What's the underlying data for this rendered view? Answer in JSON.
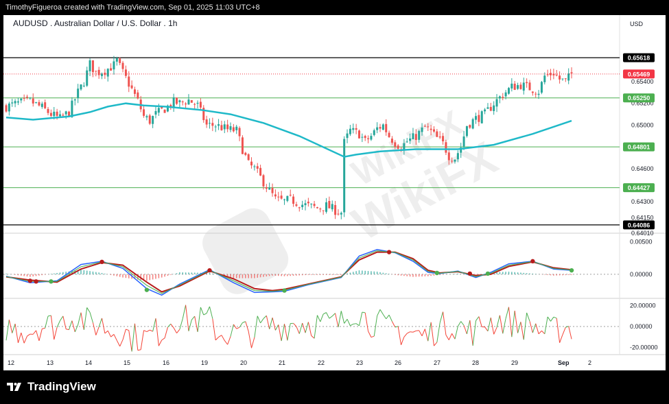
{
  "header": {
    "attribution": "TimothyFigueroa created with TradingView.com, Sep 01, 2025 11:03 UTC+8"
  },
  "footer": {
    "brand": "TradingView"
  },
  "watermark": {
    "text": "WikiFX"
  },
  "colors": {
    "bull": "#26a69a",
    "bear": "#ef5350",
    "ma": "#1fb9c8",
    "level_line": "#4caf50",
    "resistance_line": "#000000",
    "current_price": "#f23645",
    "macd_fast": "#2962ff",
    "macd_slow": "#b71c1c",
    "signal_up": "#4caf50",
    "signal_down": "#b71c1c",
    "osc_up": "#4caf50",
    "osc_down": "#f44336"
  },
  "chart_data": [
    {
      "type": "candlestick",
      "title": "AUDUSD . Australian Dollar / U.S. Dollar . 1h",
      "currency": "USD",
      "ylim": [
        0.6401,
        0.6582
      ],
      "y_ticks": [
        "0.65400",
        "0.65200",
        "0.65000",
        "0.64600",
        "0.64300",
        "0.64150",
        "0.64010"
      ],
      "x_ticks": [
        "12",
        "13",
        "14",
        "15",
        "16",
        "19",
        "20",
        "21",
        "22",
        "23",
        "26",
        "27",
        "28",
        "29",
        "Sep",
        "2"
      ],
      "levels": [
        {
          "label": "0.65618",
          "value": 0.65618,
          "style": "resistance"
        },
        {
          "label": "0.65250",
          "value": 0.6525,
          "style": "level"
        },
        {
          "label": "0.64801",
          "value": 0.64801,
          "style": "level"
        },
        {
          "label": "0.64427",
          "value": 0.64427,
          "style": "level"
        },
        {
          "label": "0.64086",
          "value": 0.64086,
          "style": "support"
        }
      ],
      "current_price": {
        "label": "0.65469",
        "value": 0.65469
      },
      "close_path": [
        [
          0,
          0.6517
        ],
        [
          4,
          0.652
        ],
        [
          8,
          0.6522
        ],
        [
          12,
          0.6516
        ],
        [
          15,
          0.651
        ],
        [
          18,
          0.6506
        ],
        [
          21,
          0.6512
        ],
        [
          24,
          0.653
        ],
        [
          26,
          0.654
        ],
        [
          28,
          0.6556
        ],
        [
          30,
          0.6548
        ],
        [
          33,
          0.655
        ],
        [
          36,
          0.6555
        ],
        [
          37,
          0.6559
        ],
        [
          39,
          0.6548
        ],
        [
          41,
          0.6538
        ],
        [
          44,
          0.6522
        ],
        [
          46,
          0.6508
        ],
        [
          48,
          0.6504
        ],
        [
          50,
          0.651
        ],
        [
          53,
          0.6515
        ],
        [
          56,
          0.6521
        ],
        [
          58,
          0.652
        ],
        [
          61,
          0.6523
        ],
        [
          64,
          0.6518
        ],
        [
          67,
          0.65
        ],
        [
          70,
          0.65
        ],
        [
          72,
          0.6498
        ],
        [
          74,
          0.6496
        ],
        [
          77,
          0.6495
        ],
        [
          79,
          0.6478
        ],
        [
          81,
          0.6464
        ],
        [
          83,
          0.646
        ],
        [
          86,
          0.6448
        ],
        [
          88,
          0.644
        ],
        [
          90,
          0.6432
        ],
        [
          93,
          0.643
        ],
        [
          95,
          0.6432
        ],
        [
          98,
          0.6428
        ],
        [
          101,
          0.6426
        ],
        [
          104,
          0.6424
        ],
        [
          107,
          0.6426
        ],
        [
          110,
          0.6422
        ],
        [
          112,
          0.642
        ],
        [
          113,
          0.6484
        ],
        [
          115,
          0.6495
        ],
        [
          118,
          0.6492
        ],
        [
          120,
          0.6485
        ],
        [
          122,
          0.649
        ],
        [
          124,
          0.6497
        ],
        [
          126,
          0.65
        ],
        [
          128,
          0.649
        ],
        [
          130,
          0.6484
        ],
        [
          132,
          0.648
        ],
        [
          134,
          0.6485
        ],
        [
          137,
          0.649
        ],
        [
          140,
          0.6498
        ],
        [
          142,
          0.6494
        ],
        [
          144,
          0.6488
        ],
        [
          146,
          0.6483
        ],
        [
          148,
          0.6472
        ],
        [
          150,
          0.647
        ],
        [
          152,
          0.648
        ],
        [
          154,
          0.65
        ],
        [
          157,
          0.6506
        ],
        [
          160,
          0.651
        ],
        [
          163,
          0.652
        ],
        [
          166,
          0.6528
        ],
        [
          169,
          0.6535
        ],
        [
          172,
          0.6537
        ],
        [
          175,
          0.6534
        ],
        [
          178,
          0.6531
        ],
        [
          180,
          0.6545
        ],
        [
          183,
          0.6548
        ],
        [
          185,
          0.6542
        ],
        [
          187,
          0.654
        ],
        [
          189,
          0.6547
        ]
      ],
      "ma_path": [
        [
          0,
          0.6507
        ],
        [
          9,
          0.6505
        ],
        [
          21,
          0.6508
        ],
        [
          28,
          0.6512
        ],
        [
          34,
          0.6517
        ],
        [
          40,
          0.652
        ],
        [
          46,
          0.6518
        ],
        [
          53,
          0.6517
        ],
        [
          65,
          0.6514
        ],
        [
          75,
          0.651
        ],
        [
          86,
          0.6502
        ],
        [
          98,
          0.649
        ],
        [
          113,
          0.6471
        ],
        [
          117,
          0.6473
        ],
        [
          125,
          0.6476
        ],
        [
          137,
          0.6478
        ],
        [
          151,
          0.6478
        ],
        [
          163,
          0.6482
        ],
        [
          176,
          0.6492
        ],
        [
          189,
          0.6504
        ]
      ]
    },
    {
      "type": "macd",
      "ylim": [
        -0.0037,
        0.0063
      ],
      "y_ticks": [
        "0.00500",
        "0.00000"
      ],
      "fast_path": [
        [
          0,
          -0.0003
        ],
        [
          8,
          -0.0013
        ],
        [
          17,
          -0.001
        ],
        [
          25,
          0.0015
        ],
        [
          32,
          0.002
        ],
        [
          39,
          0.0009
        ],
        [
          47,
          -0.0022
        ],
        [
          52,
          -0.0032
        ],
        [
          58,
          -0.0015
        ],
        [
          68,
          0.0007
        ],
        [
          76,
          -0.0013
        ],
        [
          83,
          -0.0028
        ],
        [
          89,
          -0.0027
        ],
        [
          93,
          -0.0026
        ],
        [
          101,
          -0.0016
        ],
        [
          112,
          -0.0005
        ],
        [
          118,
          0.0028
        ],
        [
          124,
          0.0038
        ],
        [
          130,
          0.0033
        ],
        [
          136,
          0.002
        ],
        [
          141,
          0.0003
        ],
        [
          145,
          0.0001
        ],
        [
          151,
          0.0005
        ],
        [
          157,
          -0.0005
        ],
        [
          162,
          0.0003
        ],
        [
          168,
          0.0016
        ],
        [
          176,
          0.002
        ],
        [
          183,
          0.0008
        ],
        [
          189,
          0.0006
        ]
      ],
      "slow_path": [
        [
          0,
          -0.0004
        ],
        [
          8,
          -0.0009
        ],
        [
          17,
          -0.0012
        ],
        [
          25,
          0.0008
        ],
        [
          32,
          0.0018
        ],
        [
          39,
          0.0014
        ],
        [
          47,
          -0.0012
        ],
        [
          52,
          -0.0027
        ],
        [
          58,
          -0.0018
        ],
        [
          68,
          0.0005
        ],
        [
          76,
          -0.0007
        ],
        [
          83,
          -0.0022
        ],
        [
          89,
          -0.0025
        ],
        [
          93,
          -0.0023
        ],
        [
          101,
          -0.0015
        ],
        [
          112,
          -0.0004
        ],
        [
          118,
          0.0022
        ],
        [
          124,
          0.0034
        ],
        [
          130,
          0.0034
        ],
        [
          136,
          0.0024
        ],
        [
          141,
          0.0006
        ],
        [
          145,
          0.0002
        ],
        [
          151,
          0.0004
        ],
        [
          157,
          -0.0002
        ],
        [
          162,
          0.0
        ],
        [
          168,
          0.0012
        ],
        [
          176,
          0.0019
        ],
        [
          183,
          0.001
        ],
        [
          189,
          0.0007
        ]
      ],
      "cross_markers": [
        {
          "x": 8,
          "y": -0.001,
          "dir": "down"
        },
        {
          "x": 10,
          "y": -0.0011,
          "dir": "down"
        },
        {
          "x": 15,
          "y": -0.0011,
          "dir": "up"
        },
        {
          "x": 32,
          "y": 0.0019,
          "dir": "down"
        },
        {
          "x": 47,
          "y": -0.0024,
          "dir": "up"
        },
        {
          "x": 68,
          "y": 0.0006,
          "dir": "down"
        },
        {
          "x": 93,
          "y": -0.0025,
          "dir": "up"
        },
        {
          "x": 128,
          "y": 0.0034,
          "dir": "down"
        },
        {
          "x": 144,
          "y": 0.0002,
          "dir": "up"
        },
        {
          "x": 155,
          "y": 0.0001,
          "dir": "down"
        },
        {
          "x": 161,
          "y": 0.0001,
          "dir": "up"
        },
        {
          "x": 176,
          "y": 0.002,
          "dir": "down"
        },
        {
          "x": 189,
          "y": 0.0006,
          "dir": "up"
        }
      ]
    },
    {
      "type": "oscillator",
      "ylim": [
        -27,
        27
      ],
      "y_ticks": [
        "20.00000",
        "0.00000",
        "-20.00000"
      ]
    }
  ]
}
